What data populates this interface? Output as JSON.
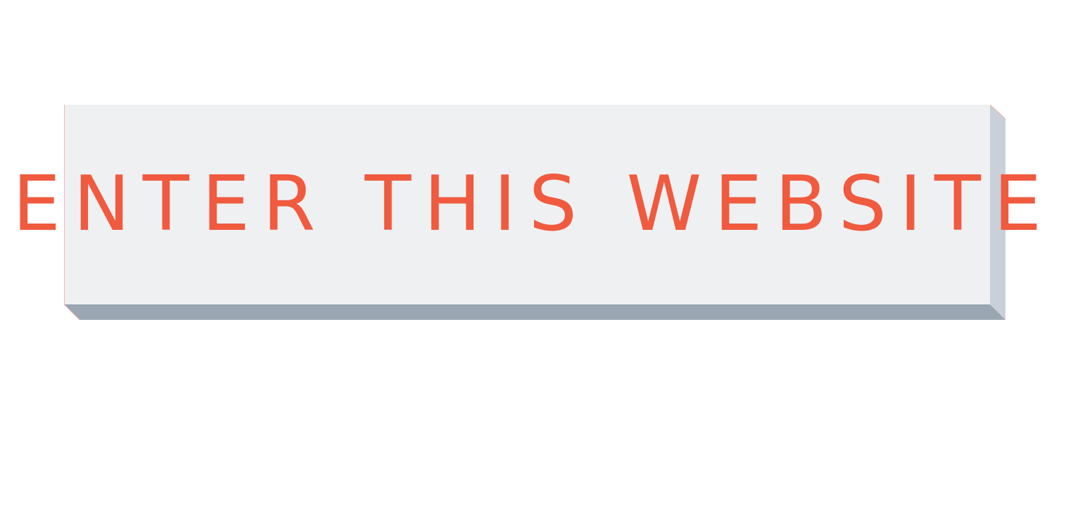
{
  "enter_button": {
    "label": "ENTER THIS WEBSITE"
  },
  "colors": {
    "label": "#f05a3f",
    "face": "#eff0f2",
    "side_right": "#c9d0d9",
    "side_bottom": "#9aa6b2",
    "edge_accent": "#f2b8ad"
  }
}
